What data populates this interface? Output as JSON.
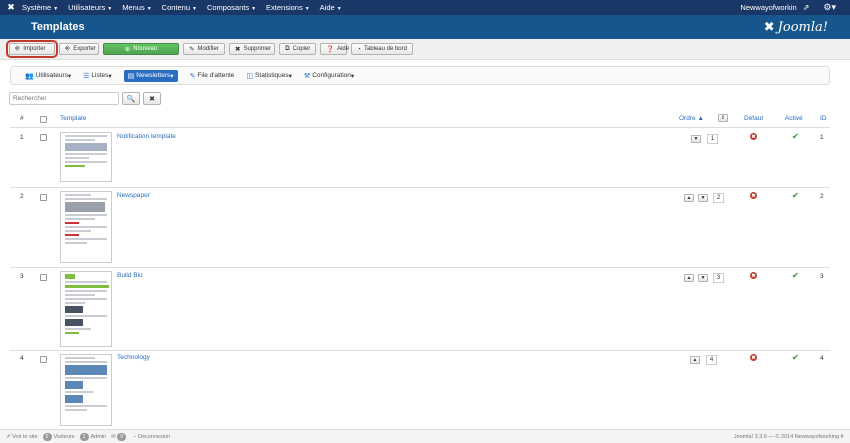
{
  "topbar": {
    "menu": [
      "Système",
      "Utilisateurs",
      "Menus",
      "Contenu",
      "Composants",
      "Extensions",
      "Aide"
    ],
    "site_name": "Newwayofworkin",
    "icons": [
      "joomla-icon",
      "external-link-icon",
      "gear-icon"
    ]
  },
  "header": {
    "title": "Templates",
    "brand": "Joomla!"
  },
  "toolbar": {
    "import": "Importer",
    "export": "Exporter",
    "new": "Nouveau",
    "edit": "Modifier",
    "delete": "Supprimer",
    "copy": "Copier",
    "help": "Aide",
    "dashboard": "Tableau de bord"
  },
  "subnav": {
    "users": "Utilisateurs",
    "lists": "Listes",
    "newsletters": "Newsletters",
    "queue": "File d'attente",
    "stats": "Statistiques",
    "config": "Configuration"
  },
  "search": {
    "placeholder": "Rechercher"
  },
  "table": {
    "headers": {
      "num": "#",
      "template": "Template",
      "order": "Ordre",
      "default": "Défaut",
      "active": "Activé",
      "id": "ID"
    },
    "rows": [
      {
        "num": "1",
        "name": "Notification template",
        "order": "1",
        "id": "1"
      },
      {
        "num": "2",
        "name": "Newspaper",
        "order": "2",
        "id": "2"
      },
      {
        "num": "3",
        "name": "Build Bio",
        "order": "3",
        "id": "3"
      },
      {
        "num": "4",
        "name": "Technology",
        "order": "4",
        "id": "4"
      }
    ]
  },
  "footer": {
    "view_site": "Voir le site",
    "visitors_count": "0",
    "visitors": "Visiteurs",
    "admin_count": "1",
    "admin": "Admin",
    "messages_count": "0",
    "logout": "Déconnexion",
    "copyright": "Joomla! 3.3.6 — © 2014 Newwayofworking fr"
  },
  "colors": {
    "topbar": "#1a3867",
    "header": "#17568c",
    "link": "#2a6dc0",
    "new_button": "#51a351",
    "highlight": "#c0392b",
    "unpublished": "#c0392b",
    "published": "#4aa54a"
  }
}
